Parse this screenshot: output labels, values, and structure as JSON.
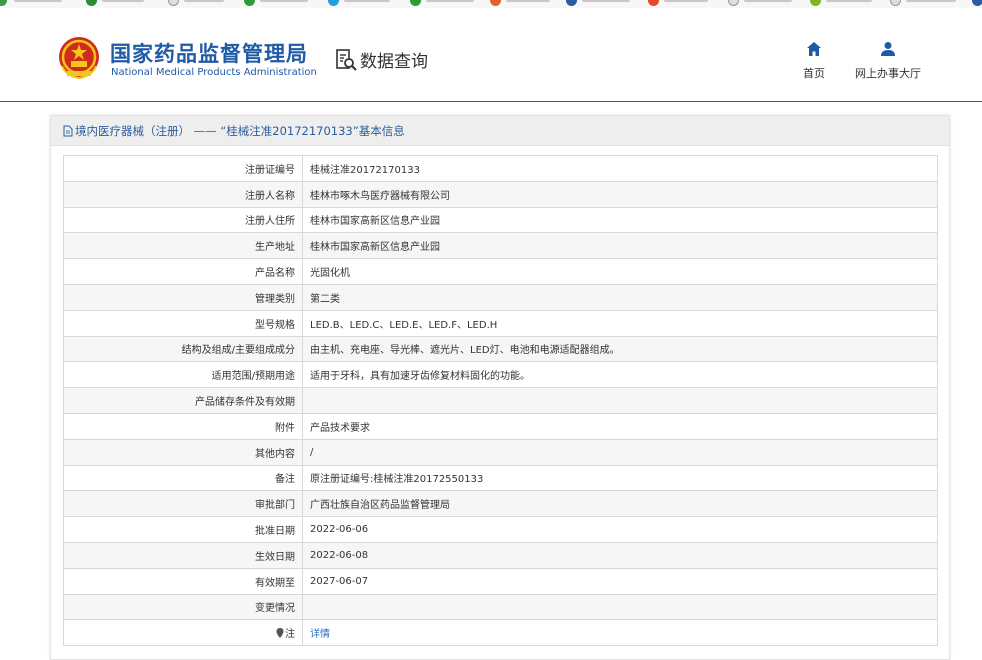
{
  "header": {
    "brand_cn": "国家药品监督管理局",
    "brand_en": "National Medical Products Administration",
    "data_query_label": "数据查询",
    "nav": [
      {
        "label": "首页",
        "icon": "home-icon"
      },
      {
        "label": "网上办事大厅",
        "icon": "user-icon"
      }
    ]
  },
  "panel": {
    "title": "境内医疗器械（注册） —— “桂械注准20172170133”基本信息",
    "icon": "document-icon"
  },
  "rows": [
    {
      "key": "注册证编号",
      "value": "桂械注准20172170133"
    },
    {
      "key": "注册人名称",
      "value": "桂林市啄木鸟医疗器械有限公司"
    },
    {
      "key": "注册人住所",
      "value": "桂林市国家高新区信息产业园"
    },
    {
      "key": "生产地址",
      "value": "桂林市国家高新区信息产业园"
    },
    {
      "key": "产品名称",
      "value": "光固化机"
    },
    {
      "key": "管理类别",
      "value": "第二类"
    },
    {
      "key": "型号规格",
      "value": "LED.B、LED.C、LED.E、LED.F、LED.H"
    },
    {
      "key": "结构及组成/主要组成成分",
      "value": "由主机、充电座、导光棒、遮光片、LED灯、电池和电源适配器组成。"
    },
    {
      "key": "适用范围/预期用途",
      "value": "适用于牙科，具有加速牙齿修复材料固化的功能。"
    },
    {
      "key": "产品储存条件及有效期",
      "value": ""
    },
    {
      "key": "附件",
      "value": "产品技术要求"
    },
    {
      "key": "其他内容",
      "value": "/"
    },
    {
      "key": "备注",
      "value": "原注册证编号:桂械注准20172550133"
    },
    {
      "key": "审批部门",
      "value": "广西壮族自治区药品监督管理局"
    },
    {
      "key": "批准日期",
      "value": "2022-06-06"
    },
    {
      "key": "生效日期",
      "value": "2022-06-08"
    },
    {
      "key": "有效期至",
      "value": "2027-06-07"
    },
    {
      "key": "变更情况",
      "value": ""
    },
    {
      "key": "注",
      "value": "详情",
      "icon": "pin-icon"
    }
  ],
  "colors": {
    "brand": "#1f5aa6",
    "link": "#2a6ebb",
    "header_rule": "#2a5d9f"
  }
}
